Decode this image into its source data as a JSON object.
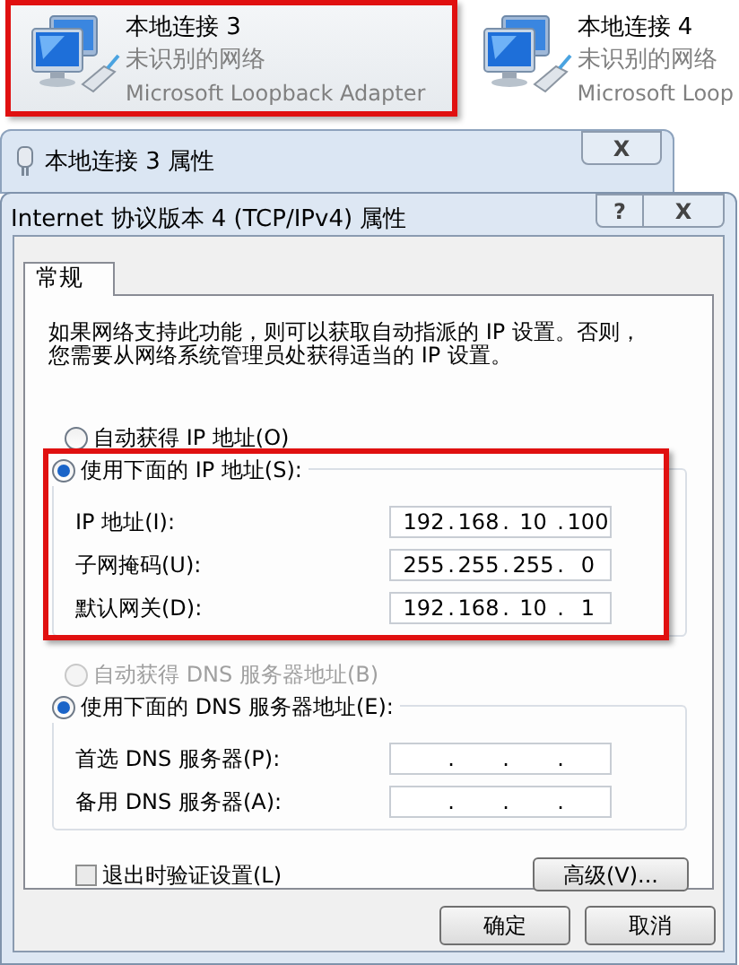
{
  "adapters": [
    {
      "name": "本地连接 3",
      "status": "未识别的网络",
      "device": "Microsoft Loopback Adapter",
      "highlighted": true
    },
    {
      "name": "本地连接 4",
      "status": "未识别的网络",
      "device": "Microsoft Loop",
      "highlighted": false
    }
  ],
  "back_dialog": {
    "title": "本地连接 3 属性",
    "close": "X"
  },
  "dialog": {
    "title": "Internet 协议版本 4 (TCP/IPv4) 属性",
    "help": "?",
    "close": "X"
  },
  "tabs": [
    {
      "label": "常规",
      "selected": true
    }
  ],
  "description": [
    "如果网络支持此功能，则可以获取自动指派的 IP 设置。否则，",
    "您需要从网络系统管理员处获得适当的 IP 设置。"
  ],
  "separator": ".",
  "ip": {
    "auto": {
      "label": "自动获得 IP 地址(O)",
      "selected": false,
      "disabled": false
    },
    "manual": {
      "label": "使用下面的 IP 地址(S):",
      "selected": true,
      "disabled": false
    },
    "highlighted": true,
    "fields": [
      {
        "label": "IP 地址(I):",
        "octets": [
          "192",
          "168",
          "10",
          "100"
        ]
      },
      {
        "label": "子网掩码(U):",
        "octets": [
          "255",
          "255",
          "255",
          "0"
        ]
      },
      {
        "label": "默认网关(D):",
        "octets": [
          "192",
          "168",
          "10",
          "1"
        ]
      }
    ]
  },
  "dns": {
    "auto": {
      "label": "自动获得 DNS 服务器地址(B)",
      "selected": false,
      "disabled": true
    },
    "manual": {
      "label": "使用下面的 DNS 服务器地址(E):",
      "selected": true,
      "disabled": false
    },
    "fields": [
      {
        "label": "首选 DNS 服务器(P):"
      },
      {
        "label": "备用 DNS 服务器(A):"
      }
    ]
  },
  "validate": {
    "label": "退出时验证设置(L)",
    "checked": false
  },
  "advanced_button": "高级(V)...",
  "buttons": [
    "确定",
    "取消"
  ]
}
